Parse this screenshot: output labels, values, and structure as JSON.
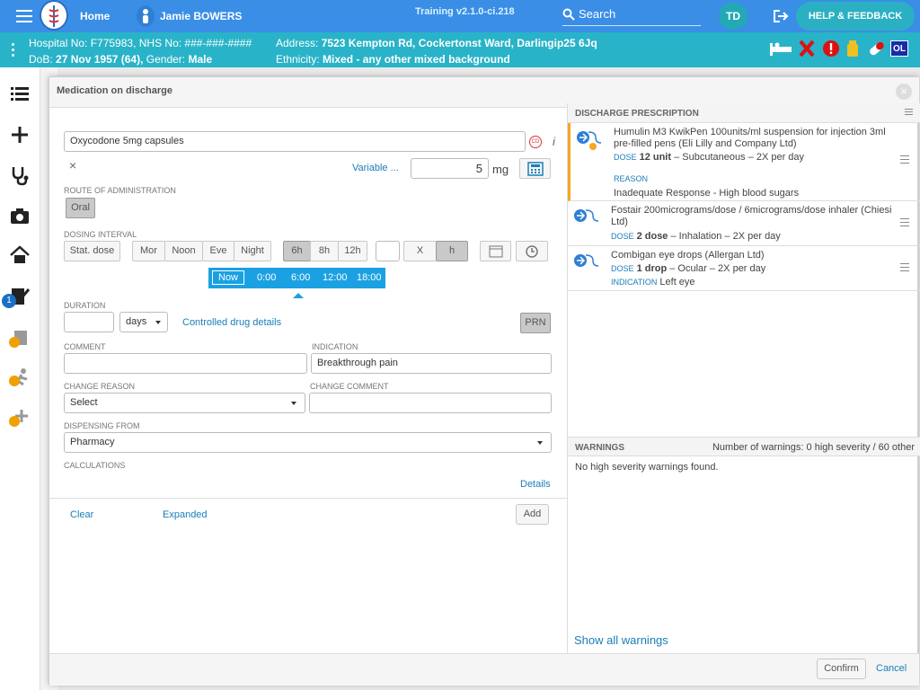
{
  "topbar": {
    "home_label": "Home",
    "patient_name": "Jamie BOWERS",
    "training_label": "Training v2.1.0-ci.218",
    "search_label": "Search",
    "avatar_initials": "TD",
    "help_label": "HELP & FEEDBACK"
  },
  "patient": {
    "line1_ids": "Hospital No: F775983, NHS No: ###-###-####",
    "dob_label": "DoB:",
    "dob_value": "27 Nov 1957 (64),",
    "gender_label": "Gender:",
    "gender_value": "Male",
    "address_label": "Address:",
    "address_value": "7523 Kempton Rd, Cockertonst Ward, Darlingip25 6Jq",
    "ethnicity_label": "Ethnicity:",
    "ethnicity_value": "Mixed - any other mixed background",
    "alert_badge": "OL"
  },
  "leftnav": {
    "badge_count": "1"
  },
  "modal": {
    "title": "Medication on discharge",
    "drug_name": "Oxycodone 5mg capsules",
    "cd_badge": "CD",
    "variable_link": "Variable ...",
    "dose_value": "5",
    "dose_unit": "mg",
    "route_label": "ROUTE OF ADMINISTRATION",
    "route_option": "Oral",
    "dosing_label": "DOSING INTERVAL",
    "stat_dose": "Stat. dose",
    "times": [
      "Mor",
      "Noon",
      "Eve",
      "Night"
    ],
    "intervals": [
      "6h",
      "8h",
      "12h"
    ],
    "x_label": "X",
    "h_label": "h",
    "timebar": {
      "now": "Now",
      "slots": [
        "0:00",
        "6:00",
        "12:00",
        "18:00"
      ]
    },
    "duration_label": "DURATION",
    "duration_unit": "days",
    "controlled_link": "Controlled drug details",
    "prn_label": "PRN",
    "comment_label": "COMMENT",
    "indication_label": "INDICATION",
    "indication_value": "Breakthrough pain",
    "change_reason_label": "CHANGE REASON",
    "change_reason_value": "Select",
    "change_comment_label": "CHANGE COMMENT",
    "dispensing_label": "DISPENSING FROM",
    "dispensing_value": "Pharmacy",
    "calculations_label": "CALCULATIONS",
    "details_link": "Details",
    "clear_link": "Clear",
    "expanded_link": "Expanded",
    "add_button": "Add"
  },
  "prescription": {
    "header": "DISCHARGE PRESCRIPTION",
    "items": [
      {
        "name": "Humulin M3 KwikPen 100units/ml suspension for injection 3ml pre-filled pens (Eli Lilly and Company Ltd)",
        "dose_key": "DOSE",
        "dose_value": "12 unit",
        "dose_rest": " – Subcutaneous – 2X per day",
        "extra_key": "REASON",
        "extra_value": "Inadequate Response - High blood sugars"
      },
      {
        "name": "Fostair 200micrograms/dose / 6micrograms/dose inhaler (Chiesi Ltd)",
        "dose_key": "DOSE",
        "dose_value": "2 dose",
        "dose_rest": " – Inhalation – 2X per day"
      },
      {
        "name": "Combigan eye drops (Allergan Ltd)",
        "dose_key": "DOSE",
        "dose_value": "1 drop",
        "dose_rest": " – Ocular – 2X per day",
        "extra_key": "INDICATION",
        "extra_value": "Left eye"
      }
    ]
  },
  "warnings": {
    "header": "WARNINGS",
    "count_text": "Number of warnings: 0 high severity / 60 other",
    "message": "No high severity warnings found.",
    "show_all": "Show all warnings"
  },
  "footer": {
    "confirm": "Confirm",
    "cancel": "Cancel"
  }
}
